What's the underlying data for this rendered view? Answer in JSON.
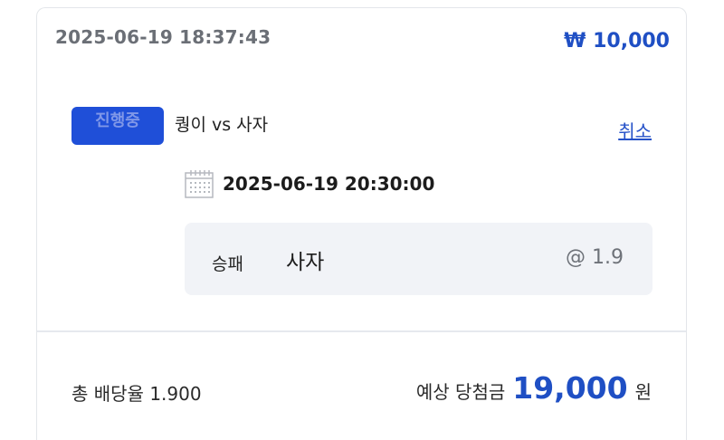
{
  "bet": {
    "placed_at": "2025-06-19 18:37:43",
    "stake": "₩ 10,000"
  },
  "match": {
    "status": "진행중",
    "title": "퀑이 vs 사자",
    "cancel_label": "취소",
    "event_datetime": "2025-06-19 20:30:00",
    "calendar_icon": "calendar-icon"
  },
  "selection": {
    "market": "승패",
    "pick": "사자",
    "odds": "@ 1.9"
  },
  "summary": {
    "total_odds": "총 배당율 1.900",
    "expected_label": "예상 당첨금",
    "expected_amount": "19,000",
    "currency_unit": "원"
  },
  "colors": {
    "accent": "#1f4fc4",
    "badge": "#1f4fd8",
    "selection_bg": "#f1f3f7"
  }
}
